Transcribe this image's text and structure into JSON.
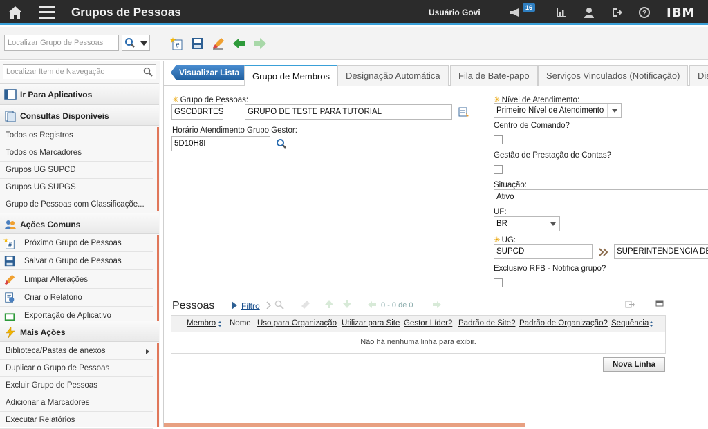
{
  "header": {
    "title": "Grupos de Pessoas",
    "user": "Usuário Govi",
    "notifications": "16",
    "brand": "IBM"
  },
  "toolbar": {
    "search_placeholder": "Localizar Grupo de Pessoas"
  },
  "sidebar": {
    "nav_search_placeholder": "Localizar Item de Navegação",
    "sections": {
      "go_apps": "Ir Para Aplicativos",
      "queries": "Consultas Disponíveis",
      "common": "Ações Comuns",
      "more": "Mais Ações"
    },
    "queries": [
      "Todos os Registros",
      "Todos os Marcadores",
      "Grupos UG SUPCD",
      "Grupos UG SUPGS",
      "Grupo de Pessoas com Classificaçõe..."
    ],
    "common_actions": [
      "Próximo Grupo de Pessoas",
      "Salvar o Grupo de Pessoas",
      "Limpar Alterações",
      "Criar o Relatório",
      "Exportação de Aplicativo"
    ],
    "more_actions": [
      "Biblioteca/Pastas de anexos",
      "Duplicar o Grupo de Pessoas",
      "Excluir Grupo de Pessoas",
      "Adicionar a Marcadores",
      "Executar Relatórios"
    ]
  },
  "tabs": {
    "list_button": "Visualizar Lista",
    "items": [
      "Grupo de Membros",
      "Designação Automática",
      "Fila de Bate-papo",
      "Serviços Vinculados (Notificação)",
      "Dis"
    ]
  },
  "form": {
    "group_label": "Grupo de Pessoas:",
    "group_code": "GSCDBRTEST",
    "group_desc": "GRUPO DE TESTE PARA TUTORIAL",
    "schedule_label": "Horário Atendimento Grupo Gestor:",
    "schedule_value": "5D10H8I",
    "level_label": "Nível de Atendimento:",
    "level_value": "Primeiro Nível de Atendimento",
    "command_label": "Centro de Comando?",
    "accountability_label": "Gestão de Prestação de Contas?",
    "status_label": "Situação:",
    "status_value": "Ativo",
    "uf_label": "UF:",
    "uf_value": "BR",
    "ug_label": "UG:",
    "ug_value": "SUPCD",
    "ug_desc": "SUPERINTENDENCIA DE I",
    "rfb_label": "Exclusivo RFB - Notifica grupo?"
  },
  "table": {
    "title": "Pessoas",
    "filter": "Filtro",
    "pager_from": "0",
    "pager_sep": "-",
    "pager_to": "0",
    "pager_of": "de",
    "pager_total": "0",
    "columns": [
      "Membro",
      "Nome",
      "Uso para Organização",
      "Utilizar para Site",
      "Gestor Líder?",
      "Padrão de Site?",
      "Padrão de Organização?",
      "Sequência"
    ],
    "empty_message": "Não há nenhuma linha para exibir.",
    "new_row": "Nova Linha"
  }
}
